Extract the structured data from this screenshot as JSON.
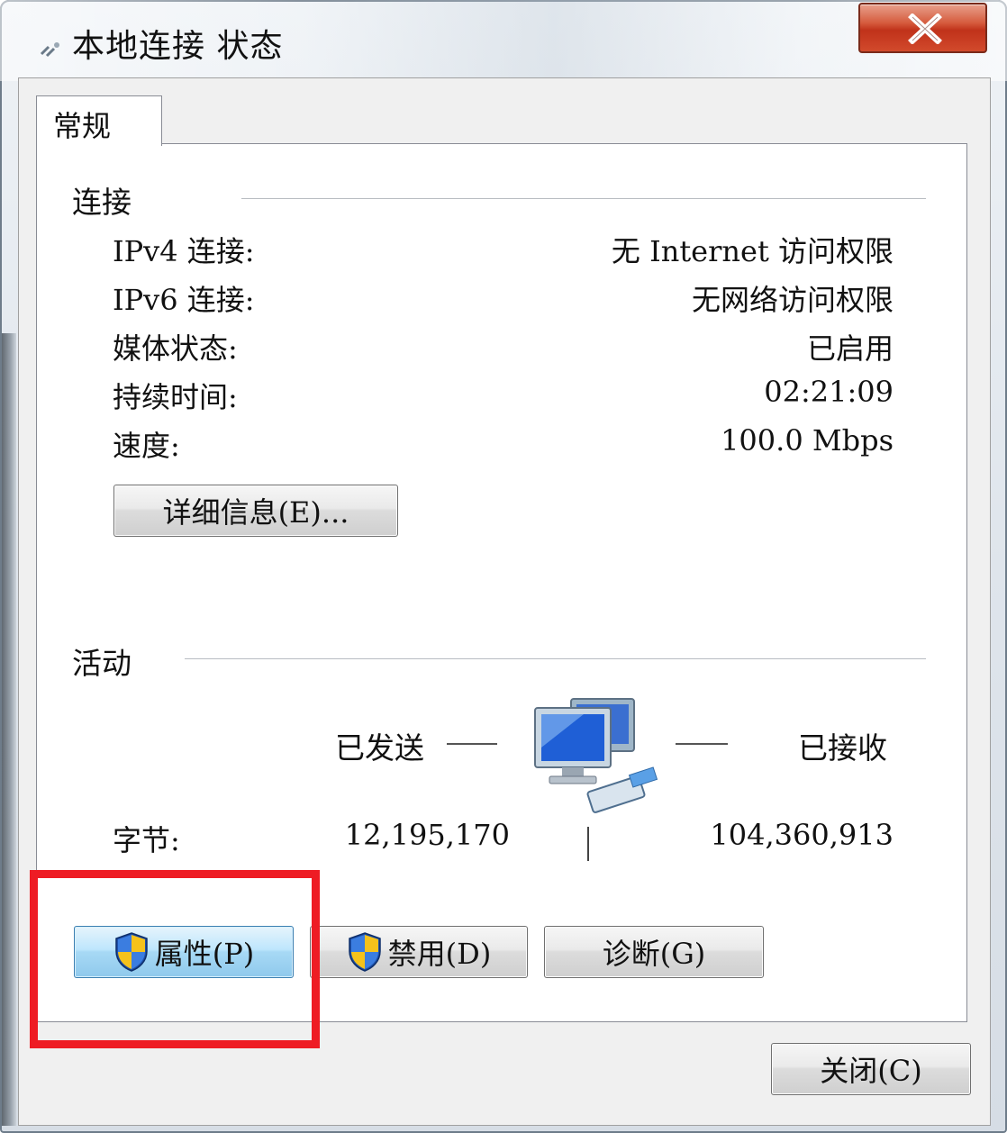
{
  "window": {
    "title": "本地连接 状态",
    "title_icon": "network-connection-icon",
    "close_icon": "close-x-icon"
  },
  "tab": {
    "label": "常规"
  },
  "connection": {
    "group_label": "连接",
    "rows": [
      {
        "label": "IPv4 连接:",
        "value": "无 Internet 访问权限"
      },
      {
        "label": "IPv6 连接:",
        "value": "无网络访问权限"
      },
      {
        "label": "媒体状态:",
        "value": "已启用"
      },
      {
        "label": "持续时间:",
        "value": "02:21:09"
      },
      {
        "label": "速度:",
        "value": "100.0 Mbps"
      }
    ],
    "details_button": "详细信息(E)..."
  },
  "activity": {
    "group_label": "活动",
    "sent_label": "已发送",
    "received_label": "已接收",
    "bytes_label": "字节:",
    "bytes_sent": "12,195,170",
    "bytes_received": "104,360,913",
    "icon": "network-computers-icon"
  },
  "buttons": {
    "properties": "属性(P)",
    "disable": "禁用(D)",
    "diagnose": "诊断(G)",
    "close": "关闭(C)",
    "shield_icon": "uac-shield-icon"
  },
  "colors": {
    "highlight": "#ee1c24",
    "focus_button": "#bee6fd",
    "close_button": "#c0321a"
  }
}
